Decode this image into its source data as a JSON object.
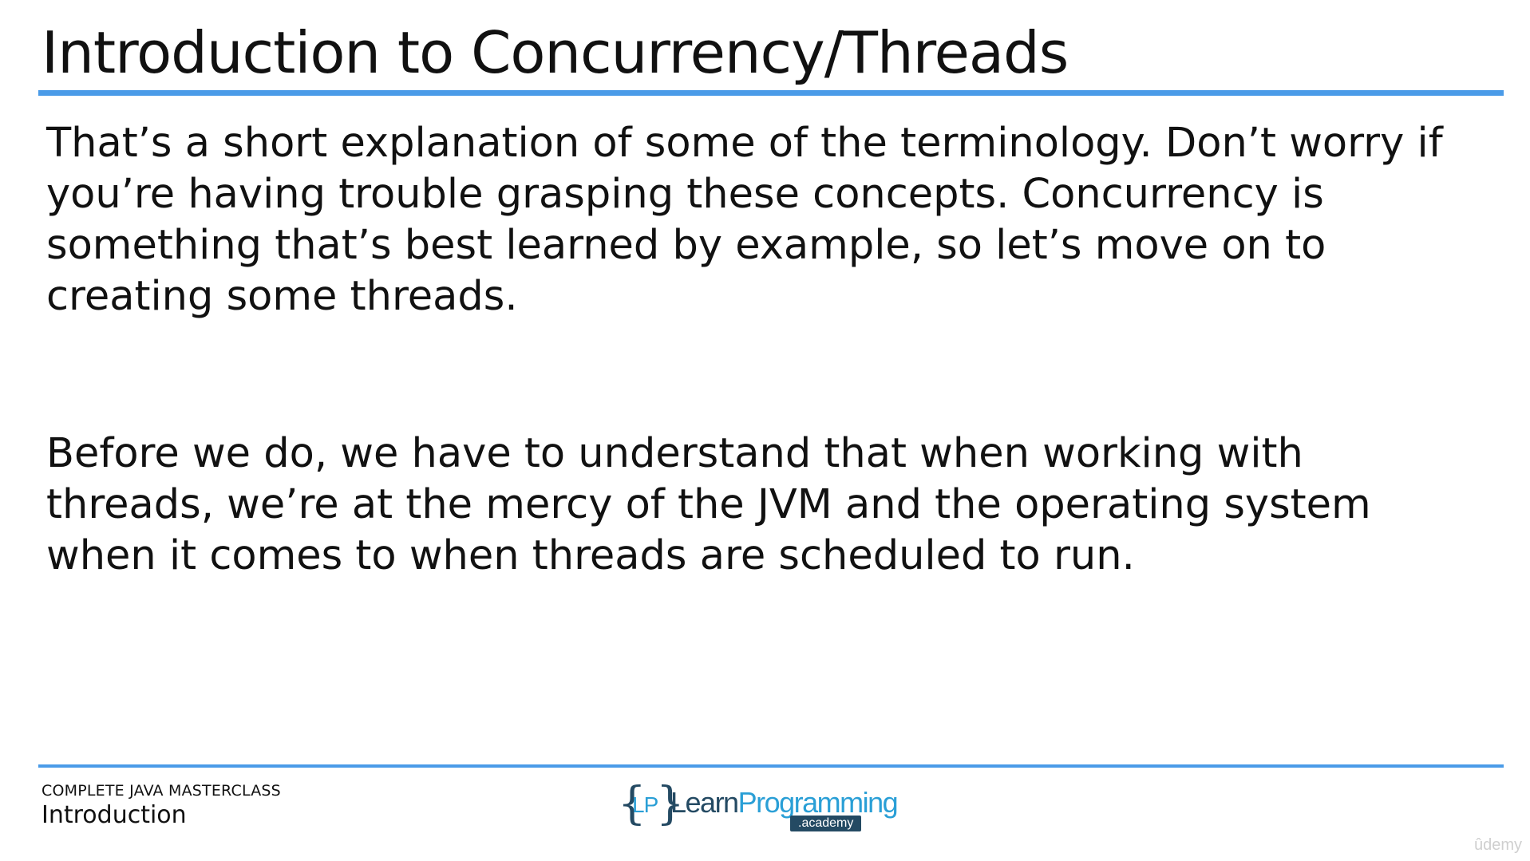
{
  "slide": {
    "title": "Introduction to Concurrency/Threads",
    "paragraphs": [
      "That’s a short explanation of some of the terminology. Don’t worry if you’re having trouble grasping these concepts. Concurrency is something that’s best learned by example, so let’s move on to creating some threads.",
      "Before we do, we have to understand that when working with threads, we’re at the mercy of the JVM and the operating system when it comes to when threads are scheduled to run."
    ]
  },
  "footer": {
    "course": "COMPLETE JAVA MASTERCLASS",
    "section": "Introduction"
  },
  "logo": {
    "brace_left": "{",
    "monogram": "LP",
    "brace_right": "}",
    "word_learn": "Learn",
    "word_programming": "Programming",
    "academy": ".academy"
  },
  "watermark": {
    "text": "ûdemy"
  },
  "colors": {
    "accent_rule": "#4a9be8",
    "logo_dark": "#244a63",
    "logo_light": "#2a9fd6"
  }
}
